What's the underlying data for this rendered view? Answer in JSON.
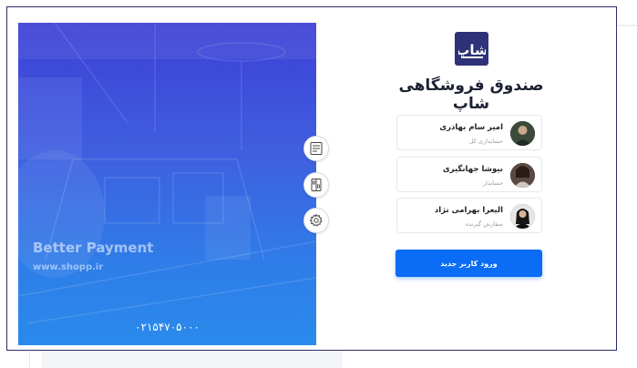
{
  "app": {
    "title": "صندوق فروشگاهی شاپ",
    "logo_text": "شاپ"
  },
  "hero": {
    "brand": "Better Payment",
    "url": "www.shopp.ir",
    "phone": "۰۲۱۵۴۷۰۵۰۰۰"
  },
  "side_actions": [
    {
      "icon": "pos-terminal-icon"
    },
    {
      "icon": "card-reader-icon"
    },
    {
      "icon": "gear-icon"
    }
  ],
  "users": [
    {
      "name": "امیر سام بهادری",
      "role": "حسابداری کل"
    },
    {
      "name": "نیوشا جهانگیری",
      "role": "حسابدار"
    },
    {
      "name": "الیعرا بهرامی نژاد",
      "role": "سفارش گیرنده"
    }
  ],
  "login_button": {
    "label": "ورود کاربر جدید"
  },
  "colors": {
    "accent": "#0b6cf5",
    "logo_bg": "#2e3278",
    "frame": "#2b2e6b",
    "hero_gradient_top": "#3d3fd6",
    "hero_gradient_bottom": "#2a8bec"
  }
}
